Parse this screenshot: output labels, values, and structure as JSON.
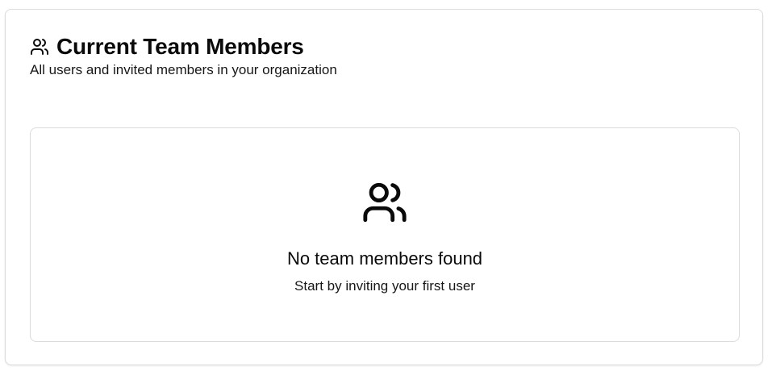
{
  "card": {
    "title": "Current Team Members",
    "title_icon": "users-icon",
    "subtitle": "All users and invited members in your organization"
  },
  "empty_state": {
    "icon": "users-icon",
    "title": "No team members found",
    "subtitle": "Start by inviting your first user"
  },
  "colors": {
    "border": "#dcdce0",
    "text": "#0a0a0a",
    "background": "#ffffff"
  }
}
